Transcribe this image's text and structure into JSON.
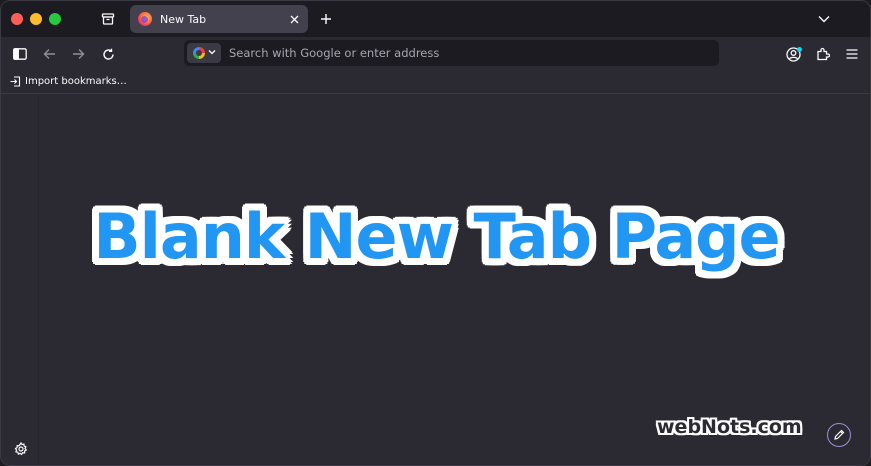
{
  "window": {
    "controls": [
      "close",
      "minimize",
      "maximize"
    ]
  },
  "tabs": [
    {
      "title": "New Tab",
      "favicon": "firefox-icon",
      "active": true
    }
  ],
  "toolbar": {
    "urlbar": {
      "placeholder": "Search with Google or enter address",
      "value": "",
      "engine_icon": "google-icon"
    }
  },
  "bookmarks": {
    "items": [
      {
        "label": "Import bookmarks…",
        "icon": "import-icon"
      }
    ]
  },
  "content": {
    "overlay_title": "Blank New Tab Page",
    "watermark": "webNots.com"
  },
  "colors": {
    "overlay_text": "#2196f3",
    "background": "#2b2a33",
    "tabstrip": "#1c1b22",
    "account_badge": "#00ddff"
  }
}
